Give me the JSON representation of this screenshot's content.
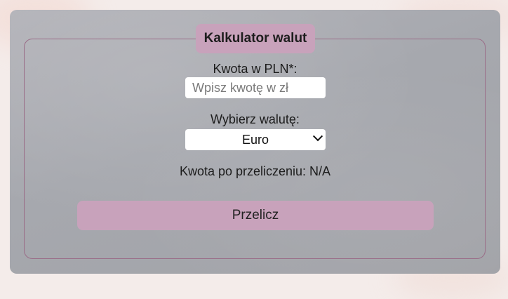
{
  "form": {
    "title": "Kalkulator walut",
    "amount_label": "Kwota w PLN*:",
    "amount_placeholder": "Wpisz kwotę w zł",
    "amount_value": "",
    "currency_label": "Wybierz walutę:",
    "currency_selected": "Euro",
    "result_label": "Kwota po przeliczeniu: N/A",
    "submit_label": "Przelicz"
  },
  "colors": {
    "accent": "#c8a2bb",
    "panel": "#a8a9ae",
    "border": "#9a6d88"
  }
}
